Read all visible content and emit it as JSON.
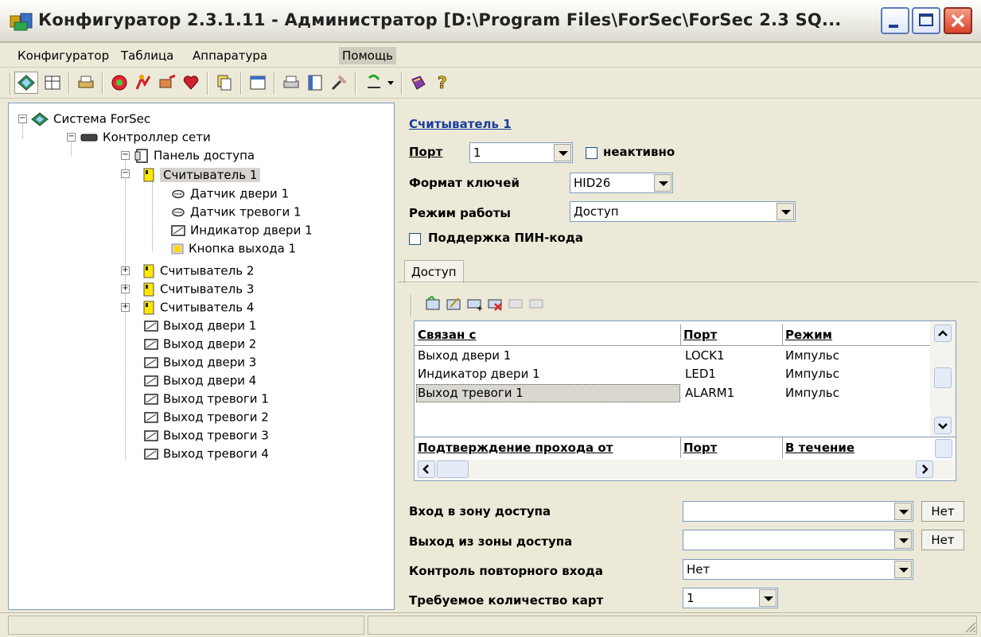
{
  "window": {
    "title": "Конфигуратор 2.3.1.11 - Администратор [D:\\Program Files\\ForSec\\ForSec 2.3 SQ..."
  },
  "menu": [
    "Конфигуратор",
    "Таблица",
    "Аппаратура",
    "Помощь"
  ],
  "tree": {
    "root": "Система ForSec",
    "controller": "Контроллер сети",
    "panel": "Панель доступа",
    "reader1": "Считыватель 1",
    "reader1_children": [
      "Датчик двери 1",
      "Датчик тревоги 1",
      "Индикатор двери 1",
      "Кнопка выхода 1"
    ],
    "readers": [
      "Считыватель 2",
      "Считыватель 3",
      "Считыватель 4"
    ],
    "outputs": [
      "Выход двери 1",
      "Выход двери 2",
      "Выход двери 3",
      "Выход двери 4",
      "Выход тревоги 1",
      "Выход тревоги 2",
      "Выход тревоги 3",
      "Выход тревоги 4"
    ]
  },
  "details": {
    "heading": "Считыватель 1",
    "port_label": "Порт",
    "port_value": "1",
    "inactive_label": "неактивно",
    "key_format_label": "Формат ключей",
    "key_format_value": "HID26",
    "mode_label": "Режим работы",
    "mode_value": "Доступ",
    "pin_label": "Поддержка ПИН-кода",
    "tab": "Доступ"
  },
  "links_table": {
    "headers": [
      "Связан с",
      "Порт",
      "Режим"
    ],
    "rows": [
      [
        "Выход двери 1",
        "LOCK1",
        "Импульс"
      ],
      [
        "Индикатор двери 1",
        "LED1",
        "Импульс"
      ],
      [
        "Выход тревоги 1",
        "ALARM1",
        "Импульс"
      ]
    ]
  },
  "confirm_table": {
    "headers": [
      "Подтверждение прохода от",
      "Порт",
      "В течение"
    ]
  },
  "zone": {
    "entry_label": "Вход в зону доступа",
    "entry_value": "",
    "exit_label": "Выход из зоны доступа",
    "exit_value": "",
    "no_label": "Нет",
    "reentry_label": "Контроль повторного входа",
    "reentry_value": "Нет",
    "cards_label": "Требуемое количество карт",
    "cards_value": "1"
  }
}
